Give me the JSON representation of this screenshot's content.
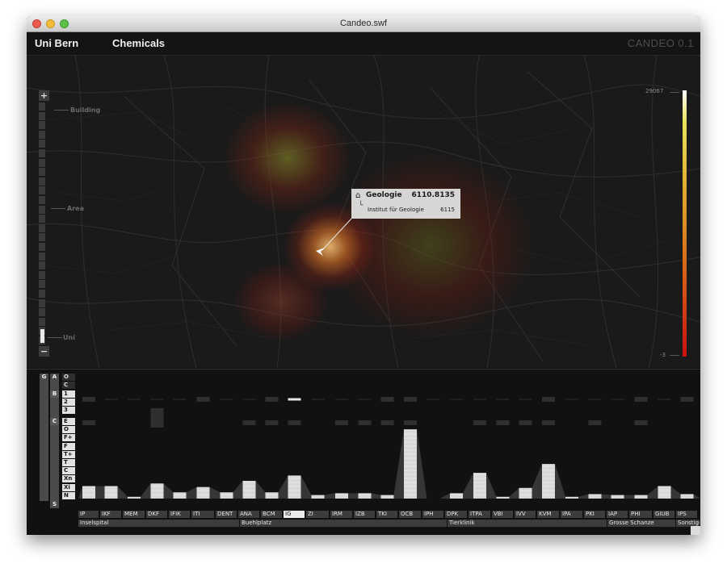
{
  "window": {
    "title": "Candeo.swf"
  },
  "app": {
    "nav_primary": "Uni Bern",
    "nav_secondary": "Chemicals",
    "version": "CANDEO 0.1"
  },
  "zoom": {
    "plus": "+",
    "minus": "−",
    "levels": [
      "Building",
      "Area",
      "Uni"
    ],
    "current_level": "Uni"
  },
  "legend": {
    "max": "29067",
    "min": "-3",
    "colors": [
      "#ffffff",
      "#e8e25a",
      "#e0b030",
      "#d86a18",
      "#c81010"
    ]
  },
  "tooltip": {
    "name": "Geologie",
    "value": "6110.8135",
    "sub_name": "Institut für Geologie",
    "sub_value": "6115",
    "icon": "home-icon"
  },
  "matrix": {
    "col_headers": [
      "G",
      "A"
    ],
    "b_label": "B",
    "c_label": "C",
    "s_label": "S",
    "a_codes": [
      "O",
      "C"
    ],
    "b_codes": [
      "1",
      "2",
      "3"
    ],
    "c_codes": [
      "E",
      "O",
      "F+",
      "F",
      "T+",
      "T",
      "C",
      "Xn",
      "Xi",
      "N"
    ]
  },
  "categories": [
    "IP",
    "IKF",
    "MEM",
    "DKF",
    "IFIK",
    "ITI",
    "DENT",
    "ANA",
    "BCM",
    "IG",
    "ZI",
    "IRM",
    "IZB",
    "TKI",
    "OCB",
    "IPH",
    "DPK",
    "ITPA",
    "VBI",
    "IVV",
    "KVM",
    "IPA",
    "PKI",
    "IAP",
    "PHI",
    "GIUB",
    "IPS"
  ],
  "selected_category": "IG",
  "groups": [
    "Inselspital",
    "Buehlplatz",
    "Tierklinik",
    "Grosse Schanze",
    "Sonstige"
  ],
  "chart_data": {
    "type": "area",
    "categories": [
      "IP",
      "IKF",
      "MEM",
      "DKF",
      "IFIK",
      "ITI",
      "DENT",
      "ANA",
      "BCM",
      "IG",
      "ZI",
      "IRM",
      "IZB",
      "TKI",
      "OCB",
      "IPH",
      "DPK",
      "ITPA",
      "VBI",
      "IVV",
      "KVM",
      "IPA",
      "PKI",
      "IAP",
      "PHI",
      "GIUB",
      "IPS"
    ],
    "series": [
      {
        "values": [
          14,
          14,
          2,
          17,
          7,
          13,
          7,
          20,
          7,
          26,
          4,
          6,
          6,
          4,
          78,
          0,
          6,
          29,
          2,
          12,
          39,
          2,
          5,
          4,
          4,
          14,
          5
        ]
      }
    ],
    "b_rows": [
      [
        1,
        0,
        0,
        0,
        0,
        1,
        0,
        0,
        1,
        2,
        0,
        0,
        0,
        1,
        1,
        0,
        0,
        0,
        0,
        0,
        1,
        0,
        0,
        0,
        1,
        0,
        1
      ],
      [
        0,
        0,
        0,
        1,
        0,
        0,
        0,
        0,
        0,
        0,
        0,
        0,
        0,
        0,
        0,
        0,
        0,
        0,
        0,
        0,
        0,
        0,
        0,
        0,
        0,
        0,
        0
      ],
      [
        1,
        0,
        0,
        1,
        0,
        0,
        0,
        1,
        1,
        1,
        0,
        1,
        1,
        1,
        1,
        0,
        0,
        1,
        1,
        1,
        1,
        0,
        1,
        0,
        1,
        0,
        0
      ]
    ]
  }
}
